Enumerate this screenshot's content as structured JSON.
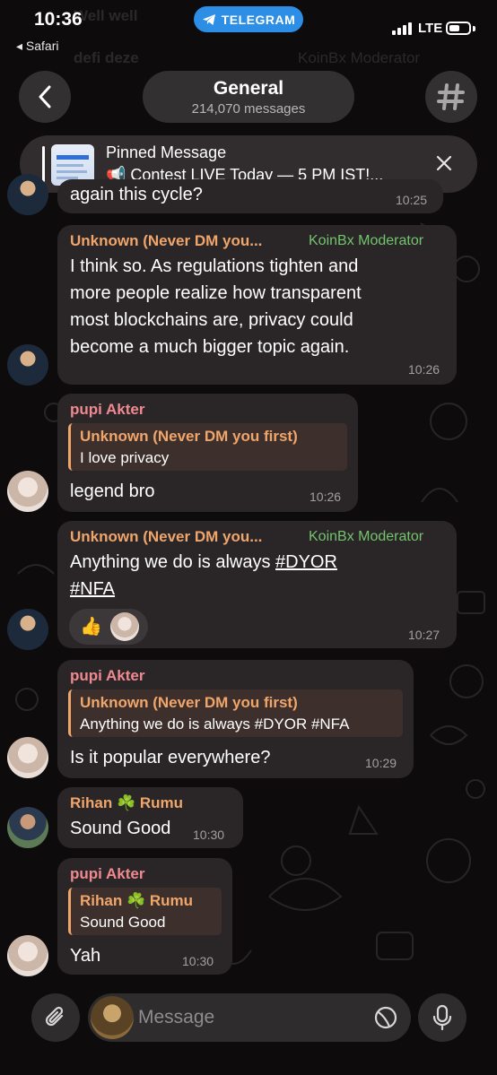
{
  "status_bar": {
    "time": "10:36",
    "back_app": "◂ Safari",
    "app_pill": "TELEGRAM",
    "network": "LTE"
  },
  "ghost_text": {
    "line1": "Well well",
    "line2": "defi deze",
    "line3": "KoinBx Moderator"
  },
  "header": {
    "title": "General",
    "subtitle": "214,070 messages",
    "back_icon": "chevron-left-icon",
    "topic_icon": "hashtag-icon"
  },
  "pinned": {
    "title": "Pinned Message",
    "text": "📢 Contest LIVE Today — 5 PM IST!..."
  },
  "messages": [
    {
      "body": "again this cycle?",
      "time": "10:25"
    },
    {
      "sender": "Unknown (Never DM you...",
      "badge": "KoinBx Moderator",
      "line1": "I think so. As regulations tighten and",
      "line2": "more people realize how transparent",
      "line3": "most blockchains are, privacy could",
      "line4": "become a much bigger topic again.",
      "time": "10:26"
    },
    {
      "sender": "pupi Akter",
      "reply_name": "Unknown (Never DM you first)",
      "reply_text": "I love privacy",
      "body": "legend bro",
      "time": "10:26"
    },
    {
      "sender": "Unknown (Never DM you...",
      "badge": "KoinBx Moderator",
      "body_prefix": "Anything we do is always ",
      "tag1": "#DYOR",
      "tag2": "#NFA",
      "reaction_emoji": "👍",
      "time": "10:27"
    },
    {
      "sender": "pupi Akter",
      "reply_name": "Unknown (Never DM you first)",
      "reply_text": "Anything we do is always #DYOR #NFA",
      "body": "Is it popular everywhere?",
      "time": "10:29"
    },
    {
      "sender": "Rihan ☘️ Rumu",
      "body": "Sound Good",
      "time": "10:30"
    },
    {
      "sender": "pupi Akter",
      "reply_name": "Rihan ☘️ Rumu",
      "reply_text": "Sound Good",
      "body": "Yah",
      "time": "10:30"
    }
  ],
  "composer": {
    "placeholder": "Message"
  },
  "colors": {
    "accent_blue": "#2d8ee6",
    "moderator_badge": "#72c46c",
    "sender_orange": "#f0a56b",
    "sender_pink": "#f08a90"
  }
}
